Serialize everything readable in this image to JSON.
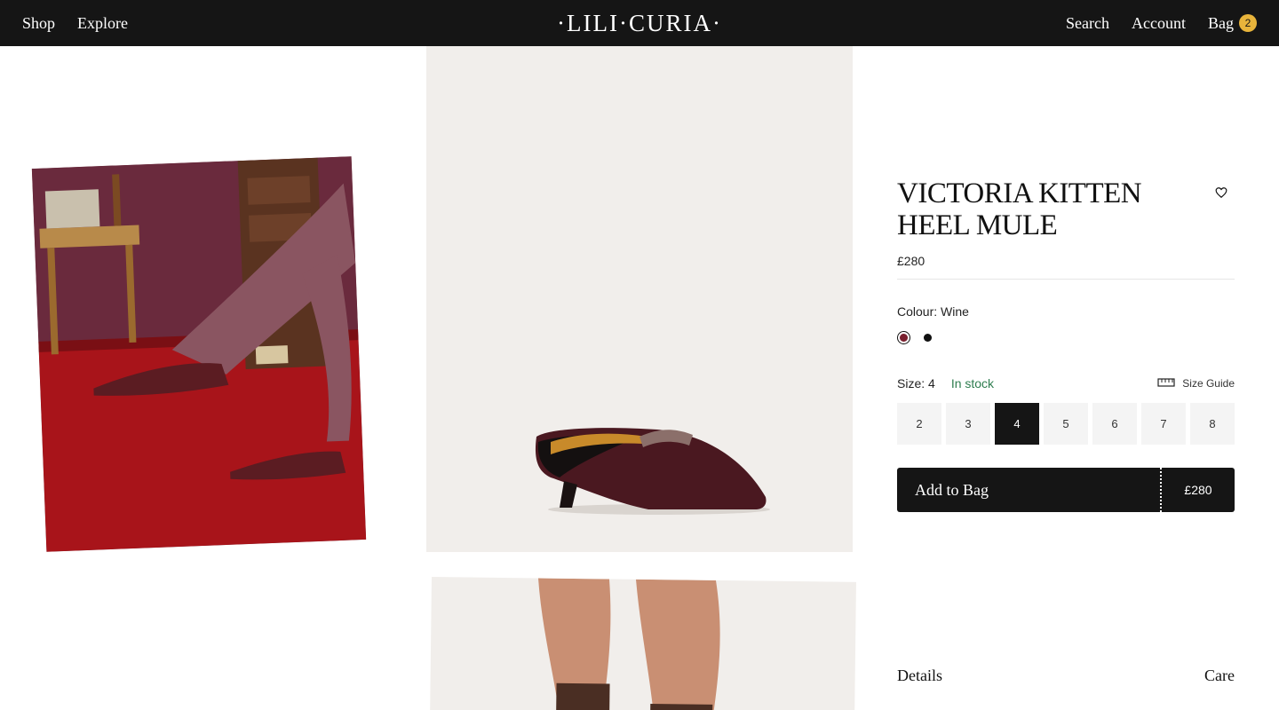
{
  "header": {
    "nav_left": [
      "Shop",
      "Explore"
    ],
    "logo": "·LILI·CURIA·",
    "nav_right": {
      "search": "Search",
      "account": "Account",
      "bag": "Bag",
      "bag_count": "2"
    }
  },
  "product": {
    "title": "VICTORIA KITTEN HEEL MULE",
    "price": "£280",
    "colour_label": "Colour: Wine",
    "colours": [
      {
        "name": "Wine",
        "hex": "#7a1f2e",
        "selected": true
      },
      {
        "name": "Black",
        "hex": "#111111",
        "selected": false
      }
    ],
    "size_label": "Size: 4",
    "stock": "In stock",
    "size_guide": "Size Guide",
    "sizes": [
      "2",
      "3",
      "4",
      "5",
      "6",
      "7",
      "8"
    ],
    "selected_size": "4",
    "add_to_bag": "Add to Bag",
    "add_to_bag_price": "£280"
  },
  "sections": {
    "details": "Details",
    "care": "Care"
  },
  "colors": {
    "header_bg": "#151515",
    "badge": "#e8b43b",
    "stock_green": "#2e7d4f",
    "image_bg": "#f1eeeb"
  }
}
